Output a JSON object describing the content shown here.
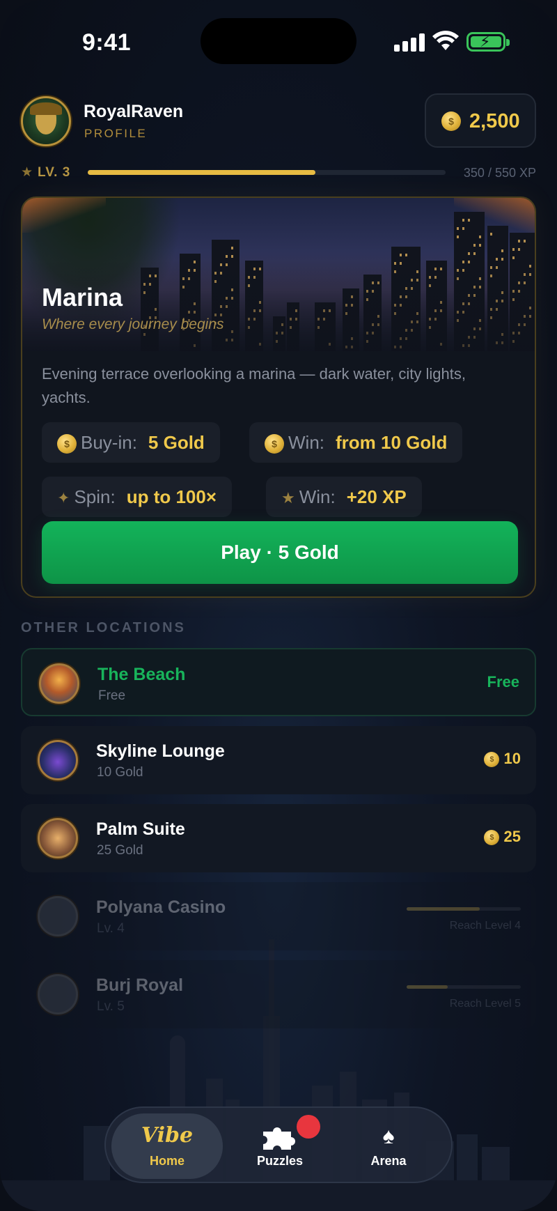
{
  "status_bar": {
    "time": "9:41"
  },
  "header": {
    "username": "RoyalRaven",
    "profile_label": "PROFILE",
    "balance": "2,500"
  },
  "level": {
    "label": "LV. 3",
    "xp_text": "350 / 550 XP",
    "xp_current": 350,
    "xp_max": 550
  },
  "featured": {
    "title": "Marina",
    "subtitle": "Where every journey begins",
    "description": "Evening terrace overlooking a marina — dark water, city lights, yachts.",
    "stats": [
      {
        "icon": "coin-icon",
        "label": "Buy-in:",
        "value": "5 Gold"
      },
      {
        "icon": "coin-icon",
        "label": "Win:",
        "value": "from 10 Gold"
      },
      {
        "icon": "sparkle-icon",
        "label": "Spin:",
        "value": "up to 100×"
      },
      {
        "icon": "star-icon",
        "label": "Win:",
        "value": "+20 XP"
      }
    ],
    "play_label": "Play · 5 Gold"
  },
  "other_locations": {
    "section_title": "OTHER LOCATIONS",
    "items": [
      {
        "name": "The Beach",
        "sub": "Free",
        "price": "Free",
        "state": "active"
      },
      {
        "name": "Skyline Lounge",
        "sub": "10 Gold",
        "price": "10",
        "state": "available"
      },
      {
        "name": "Palm Suite",
        "sub": "25 Gold",
        "price": "25",
        "state": "available"
      },
      {
        "name": "Polyana Casino",
        "sub": "Lv. 4",
        "requirement": "Reach Level 4",
        "progress": 0.64,
        "state": "locked"
      },
      {
        "name": "Burj Royal",
        "sub": "Lv. 5",
        "requirement": "Reach Level 5",
        "progress": 0.36,
        "state": "locked"
      }
    ]
  },
  "tabbar": {
    "tabs": [
      {
        "label": "Home",
        "logo": "Vibe",
        "selected": true
      },
      {
        "label": "Puzzles",
        "icon": "puzzle-icon",
        "has_badge": true
      },
      {
        "label": "Arena",
        "icon": "spade-flame-icon"
      }
    ]
  },
  "colors": {
    "gold": "#f0c94b",
    "green": "#18b45b",
    "badge_red": "#e8363e",
    "background": "#0b0f18"
  }
}
